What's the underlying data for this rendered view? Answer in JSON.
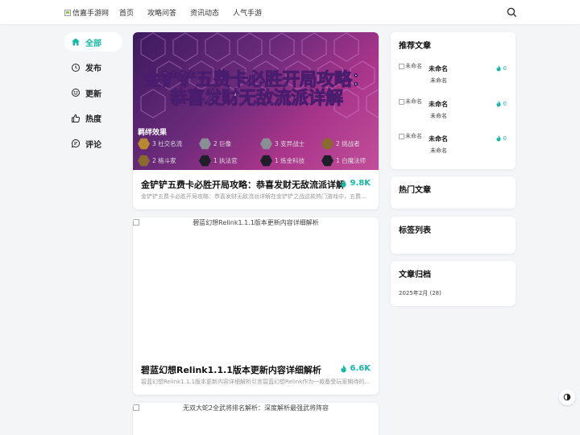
{
  "header": {
    "logo_alt": "信嘉手游网",
    "nav": [
      "首页",
      "攻略问答",
      "资讯动态",
      "人气手游"
    ]
  },
  "sidebar": {
    "items": [
      {
        "label": "全部",
        "icon": "home-icon",
        "active": true
      },
      {
        "label": "发布",
        "icon": "clock-icon",
        "active": false
      },
      {
        "label": "更新",
        "icon": "smile-icon",
        "active": false
      },
      {
        "label": "热度",
        "icon": "thumbs-up-icon",
        "active": false
      },
      {
        "label": "评论",
        "icon": "comment-icon",
        "active": false
      }
    ]
  },
  "posts": [
    {
      "hero_title": "金铲铲五费卡必胜开局攻略：恭喜发财无敌流派详解",
      "hero_bond_label": "羁绊效果",
      "hero_traits": [
        "3 社交名流",
        "2 巨像",
        "3 变异战士",
        "2 挑战者",
        "2 格斗家",
        "1 执法官",
        "1 炼金科技",
        "1 白魔法师"
      ],
      "title": "金铲铲五费卡必胜开局攻略：恭喜发财无敌流派详解",
      "views": "9.8K",
      "desc": "金铲铲五费卡必胜开局攻略：恭喜发财无敌流派详解在金铲铲之战这款热门游戏中，五费..."
    },
    {
      "image_alt": "碧蓝幻想Relink1.1.1版本更新内容详细解析",
      "title": "碧蓝幻想Relink1.1.1版本更新内容详细解析",
      "views": "6.6K",
      "desc": "碧蓝幻想Relink1.1.1版本更新内容详细解析引言碧蓝幻想Relink作为一款备受玩家期待的手..."
    },
    {
      "image_alt": "无双大蛇2全武将排名解析：深度解析最强武将阵容"
    }
  ],
  "widgets": {
    "recommended": {
      "title": "推荐文章",
      "items": [
        {
          "thumb_alt": "未命名",
          "title": "未命名",
          "tag": "未命名",
          "count": "0"
        },
        {
          "thumb_alt": "未命名",
          "title": "未命名",
          "tag": "未命名",
          "count": "0"
        },
        {
          "thumb_alt": "未命名",
          "title": "未命名",
          "tag": "未命名",
          "count": "0"
        }
      ]
    },
    "hot_title": "热门文章",
    "tags_title": "标签列表",
    "archive": {
      "title": "文章归档",
      "entry": "2025年2月 (28)"
    }
  },
  "colors": {
    "accent": "#14b8a6",
    "hero_bg": "#7a2b84"
  }
}
